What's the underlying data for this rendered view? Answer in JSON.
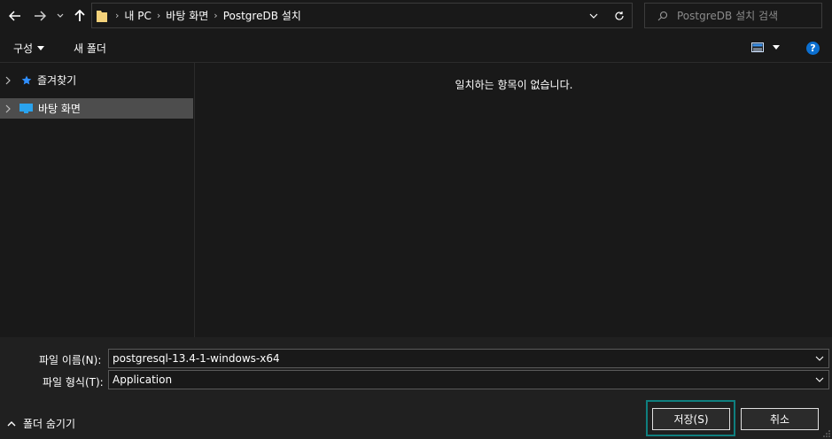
{
  "address": {
    "crumbs": [
      "내 PC",
      "바탕 화면",
      "PostgreDB 설치"
    ]
  },
  "search": {
    "placeholder": "PostgreDB 설치 검색"
  },
  "toolbar": {
    "organize_label": "구성",
    "new_folder_label": "새 폴더",
    "help_label": "?"
  },
  "nav": {
    "items": [
      {
        "label": "즐겨찾기"
      },
      {
        "label": "바탕 화면"
      }
    ]
  },
  "content": {
    "empty_message": "일치하는 항목이 없습니다."
  },
  "form": {
    "filename_label": "파일 이름(N):",
    "filename_value": "postgresql-13.4-1-windows-x64",
    "filetype_label": "파일 형식(T):",
    "filetype_value": "Application"
  },
  "footer": {
    "hide_folders_label": "폴더 숨기기",
    "save_label": "저장(S)",
    "cancel_label": "취소"
  },
  "colors": {
    "accent_outline": "#0f7f7f",
    "selected_bg": "#4d4d4d",
    "help_blue": "#0b6fd0"
  }
}
